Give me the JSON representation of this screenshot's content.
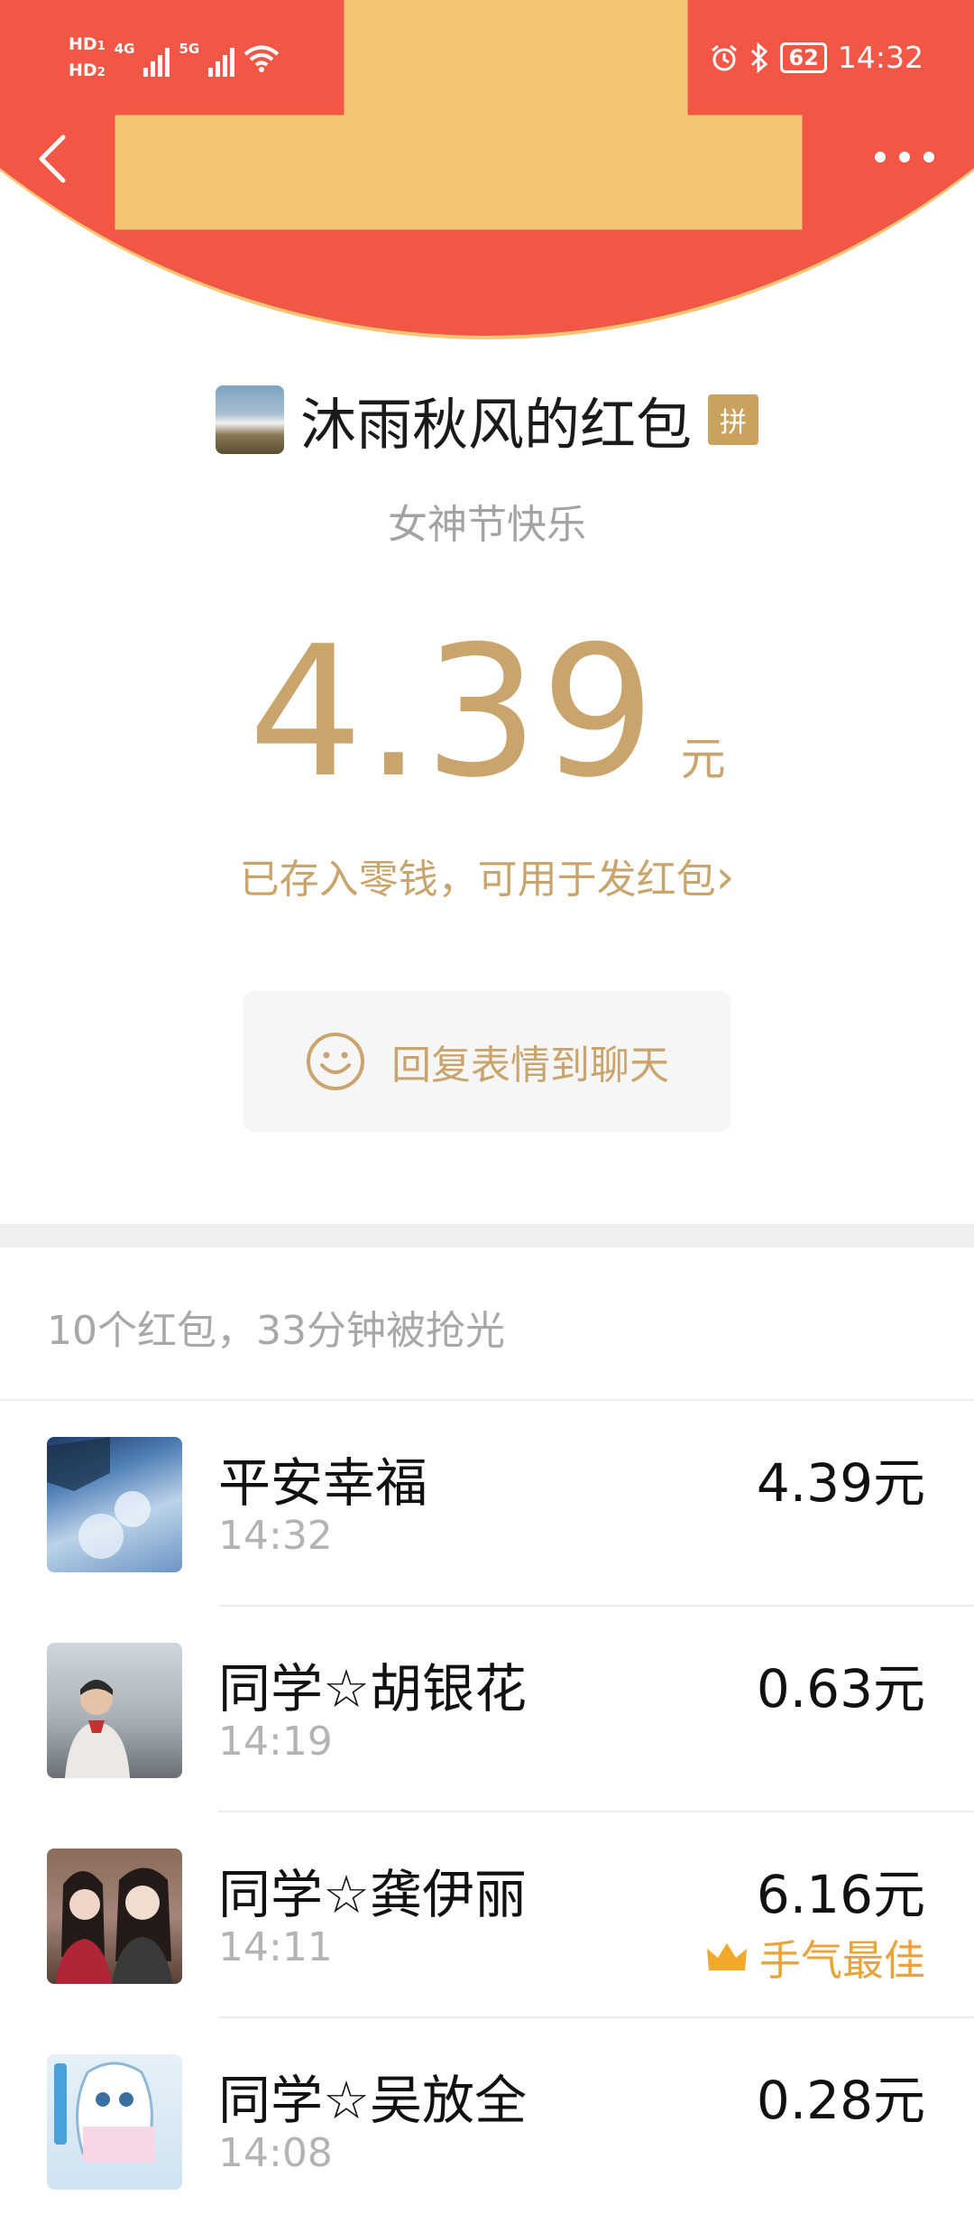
{
  "status_bar": {
    "hd1": "HD",
    "sim1": "1",
    "hd2": "HD",
    "sim2": "2",
    "net1": "4G",
    "net2": "5G",
    "battery": "62",
    "time": "14:32"
  },
  "packet": {
    "title": "沐雨秋风的红包",
    "badge": "拼",
    "greeting": "女神节快乐",
    "amount": "4.39",
    "unit": "元",
    "stored_note": "已存入零钱，可用于发红包",
    "stored_arrow": "›",
    "reply_label": "回复表情到聊天"
  },
  "summary": "10个红包，33分钟被抢光",
  "records": [
    {
      "name": "平安幸福",
      "time": "14:32",
      "amount": "4.39元",
      "best": ""
    },
    {
      "name": "同学☆胡银花",
      "time": "14:19",
      "amount": "0.63元",
      "best": ""
    },
    {
      "name": "同学☆龚伊丽",
      "time": "14:11",
      "amount": "6.16元",
      "best": "手气最佳"
    },
    {
      "name": "同学☆吴放全",
      "time": "14:08",
      "amount": "0.28元",
      "best": ""
    }
  ],
  "colors": {
    "header_red": "#f25645",
    "gold": "#c9a56d",
    "best_orange": "#e8a33a"
  }
}
